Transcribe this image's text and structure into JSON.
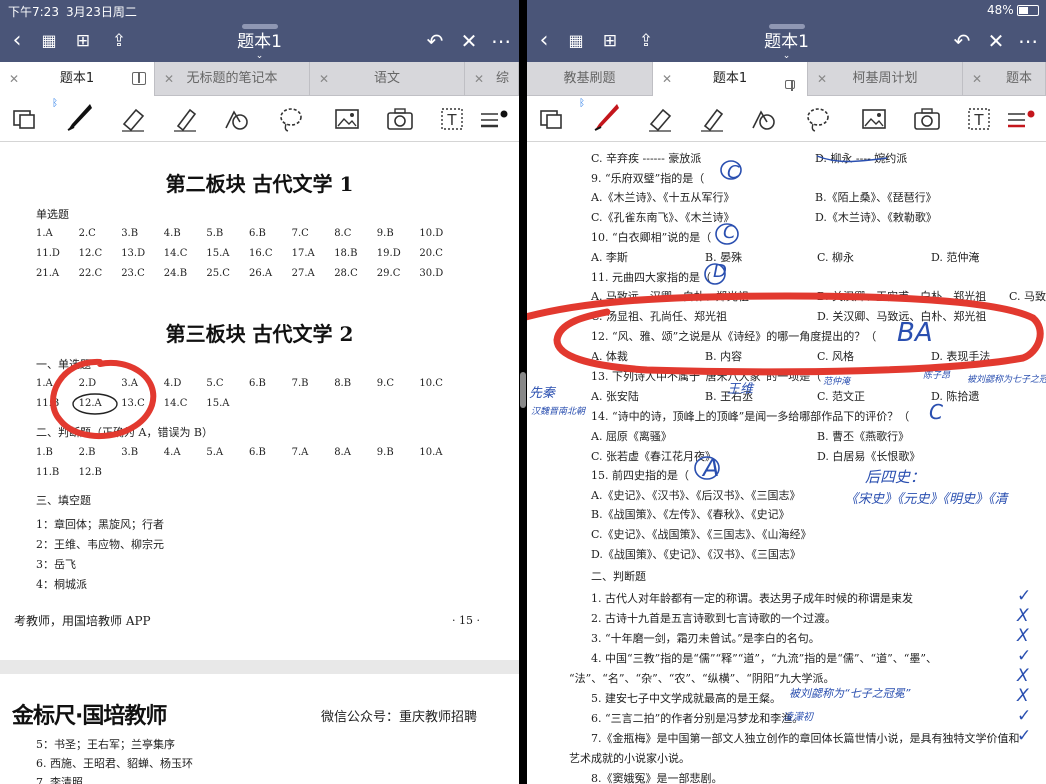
{
  "status": {
    "time": "下午7:23",
    "date": "3月23日周二",
    "battery": "48%"
  },
  "left": {
    "title": "题本1",
    "tabs": [
      {
        "label": "题本1"
      },
      {
        "label": "无标题的笔记本"
      },
      {
        "label": "语文"
      },
      {
        "label": "综"
      }
    ],
    "sec2_title": "第二板块  古代文学 1",
    "sec2_label": "单选题",
    "sec2_rows": [
      [
        "1.A",
        "2.C",
        "3.B",
        "4.B",
        "5.B",
        "6.B",
        "7.C",
        "8.C",
        "9.B",
        "10.D"
      ],
      [
        "11.D",
        "12.C",
        "13.D",
        "14.C",
        "15.A",
        "16.C",
        "17.A",
        "18.B",
        "19.D",
        "20.C"
      ],
      [
        "21.A",
        "22.C",
        "23.C",
        "24.B",
        "25.C",
        "26.A",
        "27.A",
        "28.C",
        "29.C",
        "30.D"
      ]
    ],
    "sec3_title": "第三板块  古代文学 2",
    "sec3_single": "一、单选题",
    "sec3_rows": [
      [
        "1.A",
        "2.D",
        "3.A",
        "4.D",
        "5.C",
        "6.B",
        "7.B",
        "8.B",
        "9.C",
        "10.C"
      ],
      [
        "11.B",
        "12.A",
        "13.C",
        "14.C",
        "15.A"
      ]
    ],
    "sec3_judge": "二、判断题（正确为 A，错误为 B）",
    "judge_rows": [
      [
        "1.B",
        "2.B",
        "3.B",
        "4.A",
        "5.A",
        "6.B",
        "7.A",
        "8.A",
        "9.B",
        "10.A"
      ],
      [
        "11.B",
        "12.B"
      ]
    ],
    "sec3_fill": "三、填空题",
    "fill": [
      "1：章回体；黑旋风；行者",
      "2：王维、韦应物、柳宗元",
      "3：岳飞",
      "4：桐城派"
    ],
    "footer_left": "考教师，用国培教师 APP",
    "footer_page": "· 15 ·",
    "brand": "金标尺·国培教师",
    "wechat": "微信公众号：重庆教师招聘",
    "next_lines": [
      "5：书圣；王右军；兰亭集序",
      "6. 西施、王昭君、貂蝉、杨玉环",
      "7. 李清照"
    ]
  },
  "right": {
    "title": "题本1",
    "tabs": [
      {
        "label": "教基刷题"
      },
      {
        "label": "题本1"
      },
      {
        "label": "柯基周计划"
      },
      {
        "label": "题本"
      }
    ],
    "lines": [
      "C. 辛弃疾 ------ 豪放派",
      "D. 柳永 ---- 婉约派",
      "9. “乐府双璧”指的是（",
      "A.《木兰诗》、《十五从军行》",
      "B.《陌上桑》、《琵琶行》",
      "C.《孔雀东南飞》、《木兰诗》",
      "D.《木兰诗》、《敕勒歌》",
      "10. “白衣卿相”说的是（",
      "A. 李斯",
      "B. 晏殊",
      "C. 柳永",
      "D. 范仲淹",
      "11. 元曲四大家指的是（",
      "A. 马致远、汉卿、白朴、郑光祖",
      "B. 关汉卿、王实甫、白朴、郑光祖",
      "C. 马致",
      "C. 汤显祖、孔尚任、郑光祖",
      "D. 关汉卿、马致远、白朴、郑光祖",
      "12. “风、雅、颂”之说是从《诗经》的哪一角度提出的？（",
      "A. 体裁",
      "B. 内容",
      "C. 风格",
      "D. 表现手法",
      "13. 下列诗人中不属于“唐宋八大家”的一项是（",
      "A. 张安陆",
      "B. 王右丞",
      "C. 范文正",
      "D. 陈拾遗",
      "14. “诗中的诗，顶峰上的顶峰”是闻一多给哪部作品下的评价？（",
      "A. 屈原《离骚》",
      "B. 曹丕《燕歌行》",
      "C. 张若虚《春江花月夜》",
      "D. 白居易《长恨歌》",
      "15. 前四史指的是（",
      "A.《史记》、《汉书》、《后汉书》、《三国志》",
      "B.《战国策》、《左传》、《春秋》、《史记》",
      "C.《史记》、《战国策》、《三国志》、《山海经》",
      "D.《战国策》、《史记》、《汉书》、《三国志》",
      "二、判断题",
      "1. 古代人对年龄都有一定的称谓。表达男子成年时候的称谓是束发",
      "2. 古诗十九首是五言诗歌到七言诗歌的一个过渡。",
      "3. “十年磨一剑，霜刃未曾试。”是李白的名句。",
      "4. 中国“三教”指的是“儒”“释”“道”，“九流”指的是“儒”、“道”、“墨”、",
      "“法”、“名”、“杂”、“农”、“纵横”、“阴阳”九大学派。",
      "5. 建安七子中文学成就最高的是王粲。",
      "6. “三言二拍”的作者分别是冯梦龙和李渔。",
      "7.《金瓶梅》是中国第一部文人独立创作的章回体长篇世情小说，是具有独特文学价值和",
      "艺术成就的小说家小说。",
      "8.《窦娥冤》是一部悲剧。"
    ],
    "ink": {
      "c9": "C",
      "c10": "C",
      "c11": "D",
      "c12": "BA",
      "c14": "C",
      "c15": "A",
      "note_l1": "先秦",
      "note_l2": "汉魏晋南北朝",
      "note_r1": "后四史：",
      "note_r2": "《宋史》《元史》《明史》《清",
      "note_5": "被刘勰称为“七子之冠冕”",
      "note_6": "凌濛初",
      "note_13a": "王维",
      "note_13b": "范仲淹",
      "note_13c": "陈子昂",
      "note_13d": "被刘勰称为七子之冠冕",
      "judge_marks": [
        "✓",
        "X",
        "X",
        "✓",
        "X",
        "X",
        "✓",
        "✓"
      ]
    }
  }
}
